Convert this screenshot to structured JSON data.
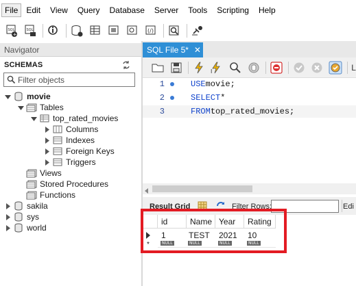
{
  "menu": {
    "items": [
      "File",
      "Edit",
      "View",
      "Query",
      "Database",
      "Server",
      "Tools",
      "Scripting",
      "Help"
    ]
  },
  "toolbar": {
    "icons": [
      "new-sql-tab-icon",
      "open-sql-script-icon",
      "inspector-icon",
      "create-schema-icon",
      "create-table-icon",
      "create-view-icon",
      "create-procedure-icon",
      "create-function-icon",
      "search-table-data-icon",
      "reconnect-icon"
    ]
  },
  "navigator": {
    "title": "Navigator",
    "schemas_label": "SCHEMAS",
    "filter_placeholder": "Filter objects",
    "tree": {
      "movie": "movie",
      "tables": "Tables",
      "table": "top_rated_movies",
      "columns": "Columns",
      "indexes": "Indexes",
      "foreign_keys": "Foreign Keys",
      "triggers": "Triggers",
      "views": "Views",
      "stored_procedures": "Stored Procedures",
      "functions": "Functions",
      "sakila": "sakila",
      "sys": "sys",
      "world": "world"
    }
  },
  "editor": {
    "tab_label": "SQL File 5*",
    "tab_close": "✕",
    "toolbar_cut_label": "L",
    "lines": [
      {
        "num": "1",
        "kw": "USE",
        "rest": " movie;"
      },
      {
        "num": "2",
        "kw": "SELECT",
        "rest": " *"
      },
      {
        "num": "3",
        "kw": "FROM",
        "rest": " top_rated_movies;"
      }
    ]
  },
  "result": {
    "grid_label": "Result Grid",
    "filter_label": "Filter Rows:",
    "edit_label": "Edi",
    "columns": [
      "id",
      "Name",
      "Year",
      "Rating"
    ],
    "row": [
      "1",
      "TEST",
      "2021",
      "10"
    ],
    "null_label": "NULL"
  },
  "colors": {
    "tab_active": "#2f8fd6",
    "keyword": "#1144cc",
    "highlight_box": "#e31b23"
  }
}
